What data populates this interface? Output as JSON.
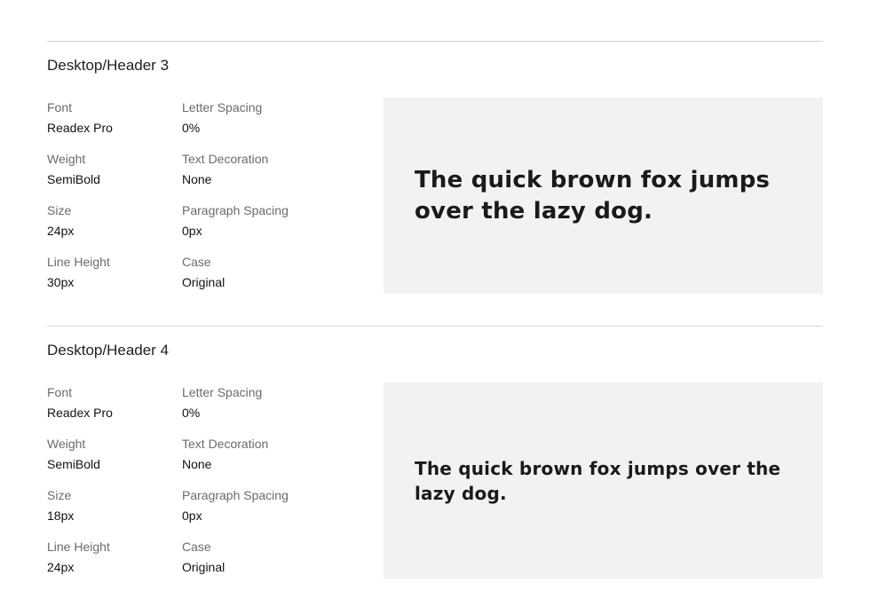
{
  "sections": [
    {
      "title": "Desktop/Header 3",
      "properties": [
        {
          "label": "Font",
          "value": "Readex Pro"
        },
        {
          "label": "Letter Spacing",
          "value": "0%"
        },
        {
          "label": "Weight",
          "value": "SemiBold"
        },
        {
          "label": "Text Decoration",
          "value": "None"
        },
        {
          "label": "Size",
          "value": "24px"
        },
        {
          "label": "Paragraph Spacing",
          "value": "0px"
        },
        {
          "label": "Line Height",
          "value": "30px"
        },
        {
          "label": "Case",
          "value": "Original"
        }
      ],
      "preview_text": "The quick brown fox jumps over the lazy dog.",
      "preview_background": "#f2f2f2"
    },
    {
      "title": "Desktop/Header 4",
      "properties": [
        {
          "label": "Font",
          "value": "Readex Pro"
        },
        {
          "label": "Letter Spacing",
          "value": "0%"
        },
        {
          "label": "Weight",
          "value": "SemiBold"
        },
        {
          "label": "Text Decoration",
          "value": "None"
        },
        {
          "label": "Size",
          "value": "18px"
        },
        {
          "label": "Paragraph Spacing",
          "value": "0px"
        },
        {
          "label": "Line Height",
          "value": "24px"
        },
        {
          "label": "Case",
          "value": "Original"
        }
      ],
      "preview_text": "The quick brown fox jumps over the lazy dog.",
      "preview_background": "#f2f2f2"
    }
  ]
}
